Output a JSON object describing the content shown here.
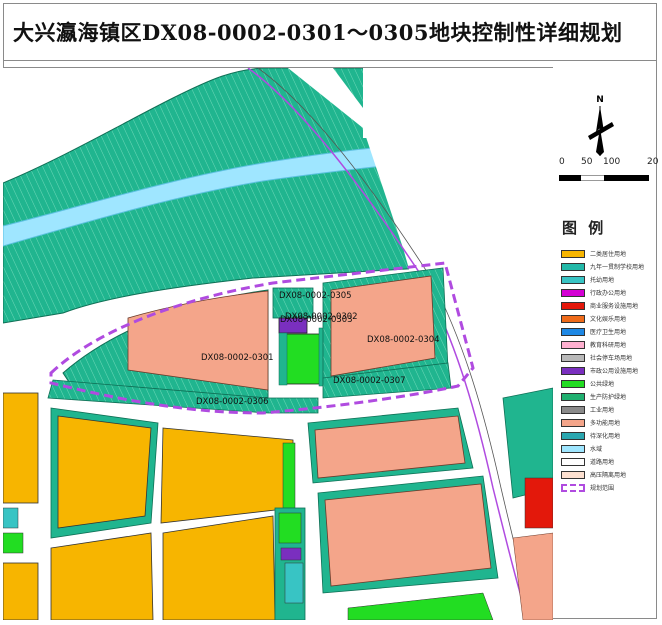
{
  "title": "大兴瀛海镇区DX08-0002-0301～0305地块控制性详细规划",
  "parcels": {
    "p0301": "DX08-0002-0301",
    "p0302": "DX08-0002-0302",
    "p0303": "DX08-0002-0303",
    "p0304": "DX08-0002-0304",
    "p0305": "DX08-0002-0305",
    "p0306": "DX08-0002-0306",
    "p0307": "DX08-0002-0307"
  },
  "scale": {
    "labels": [
      "0",
      "50",
      "100",
      "20"
    ]
  },
  "north": "N",
  "legend": {
    "title": "图 例",
    "items": [
      {
        "label": "二类居住用地",
        "color": "#f7b500"
      },
      {
        "label": "九年一贯制学校用地",
        "color": "#22b8a8"
      },
      {
        "label": "托幼用地",
        "color": "#38c4c4"
      },
      {
        "label": "行政办公用地",
        "color": "#d400d4"
      },
      {
        "label": "商业服务设施用地",
        "color": "#e3180b"
      },
      {
        "label": "文化娱乐用地",
        "color": "#ef6b1a"
      },
      {
        "label": "医疗卫生用地",
        "color": "#1e88e5"
      },
      {
        "label": "教育科研用地",
        "color": "#ffb0d0"
      },
      {
        "label": "社会停车场用地",
        "color": "#b9b9b9"
      },
      {
        "label": "市政公用设施用地",
        "color": "#7a2fbf"
      },
      {
        "label": "公共绿地",
        "color": "#22dd22"
      },
      {
        "label": "生产防护绿地",
        "color": "#20b070"
      },
      {
        "label": "工业用地",
        "color": "#8a8a8a"
      },
      {
        "label": "多功能用地",
        "color": "#f4a58a"
      },
      {
        "label": "待深化用地",
        "color": "#2aa7b0"
      },
      {
        "label": "水域",
        "color": "#9fe6ff"
      },
      {
        "label": "道路用地",
        "color": "#ffffff"
      },
      {
        "label": "高压隔离用地",
        "color": "#fde0d0"
      },
      {
        "label": "规划范围",
        "color": "#b04be0"
      }
    ]
  },
  "colors": {
    "greenbelt": "#20b58f",
    "residential": "#f7b500",
    "mixed": "#f4a58a",
    "park": "#22dd22",
    "water": "#9fe6ff",
    "boundary": "#b04be0",
    "admin": "#7a2fbf",
    "commercial": "#e3180b"
  }
}
